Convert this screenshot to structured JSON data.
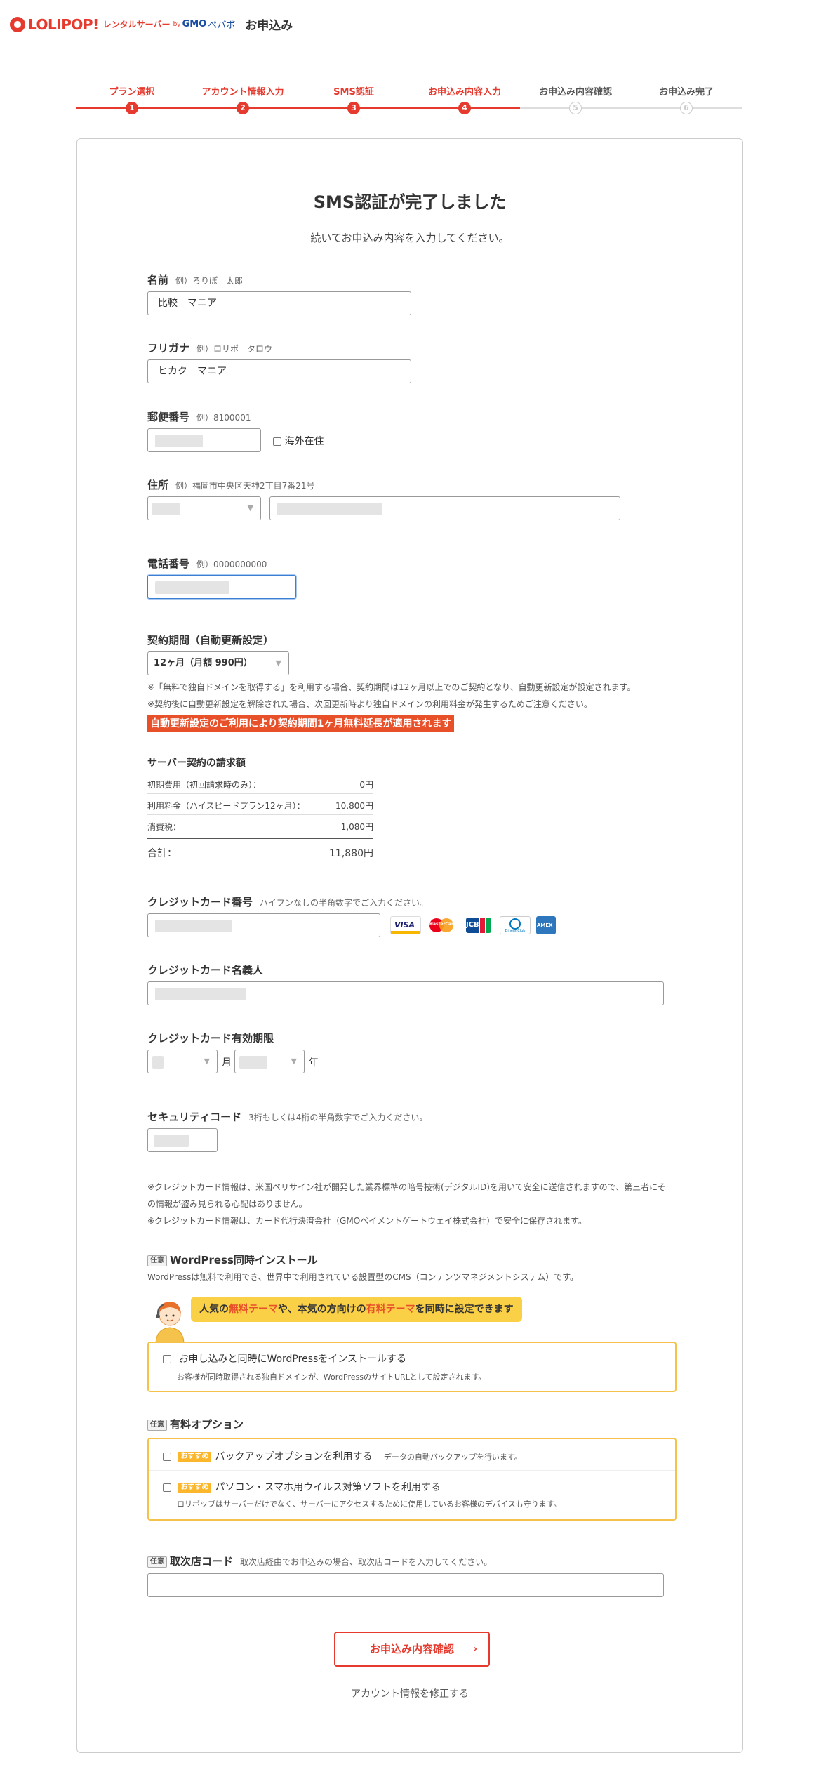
{
  "header": {
    "logo_text": "LOLIPOP!",
    "logo_sub": "レンタルサーバー",
    "logo_by": "by",
    "logo_gmo": "GMO",
    "logo_pepabo": "ペパボ",
    "page_title": "お申込み"
  },
  "steps": [
    {
      "label": "プラン選択",
      "num": "1",
      "state": "done"
    },
    {
      "label": "アカウント情報入力",
      "num": "2",
      "state": "done"
    },
    {
      "label": "SMS認証",
      "num": "3",
      "state": "done"
    },
    {
      "label": "お申込み内容入力",
      "num": "4",
      "state": "done"
    },
    {
      "label": "お申込み内容確認",
      "num": "5",
      "state": "todo"
    },
    {
      "label": "お申込み完了",
      "num": "6",
      "state": "todo"
    }
  ],
  "main": {
    "title": "SMS認証が完了しました",
    "subtitle": "続いてお申込み内容を入力してください。"
  },
  "form": {
    "name": {
      "label": "名前",
      "example": "例）ろりぽ　太郎",
      "value": "比較　マニア"
    },
    "kana": {
      "label": "フリガナ",
      "example": "例）ロリポ　タロウ",
      "value": "ヒカク　マニア"
    },
    "zip": {
      "label": "郵便番号",
      "example": "例）8100001",
      "overseas_label": "海外在住"
    },
    "address": {
      "label": "住所",
      "example": "例）福岡市中央区天神2丁目7番21号"
    },
    "phone": {
      "label": "電話番号",
      "example": "例）0000000000"
    },
    "contract": {
      "label": "契約期間（自動更新設定）",
      "selected": "12ヶ月（月額 990円）",
      "note1": "※「無料で独自ドメインを取得する」を利用する場合、契約期間は12ヶ月以上でのご契約となり、自動更新設定が設定されます。",
      "note2": "※契約後に自動更新設定を解除された場合、次回更新時より独自ドメインの利用料金が発生するためご注意ください。",
      "promo": "自動更新設定のご利用により契約期間1ヶ月無料延長が適用されます"
    },
    "billing": {
      "title": "サーバー契約の請求額",
      "rows": [
        {
          "label": "初期費用（初回請求時のみ）：",
          "value": "0円"
        },
        {
          "label": "利用料金（ハイスピードプラン12ヶ月）：",
          "value": "10,800円"
        },
        {
          "label": "消費税：",
          "value": "1,080円"
        }
      ],
      "total_label": "合計：",
      "total_value": "11,880円"
    },
    "card_number": {
      "label": "クレジットカード番号",
      "example": "ハイフンなしの半角数字でご入力ください。"
    },
    "card_brands": [
      "VISA",
      "MasterCard",
      "JCB",
      "Diners Club",
      "AMEX"
    ],
    "card_holder": {
      "label": "クレジットカード名義人"
    },
    "card_expiry": {
      "label": "クレジットカード有効期限",
      "month_unit": "月",
      "year_unit": "年"
    },
    "security_code": {
      "label": "セキュリティコード",
      "example": "3桁もしくは4桁の半角数字でご入力ください。"
    },
    "card_notes": [
      "※クレジットカード情報は、米国ベリサイン社が開発した業界標準の暗号技術(デジタルID)を用いて安全に送信されますので、第三者にそ",
      "の情報が盗み見られる心配はありません。",
      "※クレジットカード情報は、カード代行決済会社（GMOペイメントゲートウェイ株式会社）で安全に保存されます。"
    ],
    "wordpress": {
      "badge": "任意",
      "title": "WordPress同時インストール",
      "desc": "WordPressは無料で利用でき、世界中で利用されている設置型のCMS（コンテンツマネジメントシステム）です。",
      "bubble_a": "人気の",
      "bubble_b": "無料テーマ",
      "bubble_c": "や、本気の方向けの",
      "bubble_d": "有料テーマ",
      "bubble_e": "を同時に設定できます",
      "check_label": "お申し込みと同時にWordPressをインストールする",
      "check_sub": "お客様が同時取得される独自ドメインが、WordPressのサイトURLとして設定されます。"
    },
    "options": {
      "badge": "任意",
      "title": "有料オプション",
      "recommend": "おすすめ",
      "items": [
        {
          "label": "バックアップオプションを利用する",
          "desc": "データの自動バックアップを行います。",
          "sub": ""
        },
        {
          "label": "パソコン・スマホ用ウイルス対策ソフトを利用する",
          "desc": "",
          "sub": "ロリポップはサーバーだけでなく、サーバーにアクセスするために使用しているお客様のデバイスも守ります。"
        }
      ]
    },
    "agency": {
      "badge": "任意",
      "label": "取次店コード",
      "example": "取次店経由でお申込みの場合、取次店コードを入力してください。"
    }
  },
  "actions": {
    "confirm": "お申込み内容確認",
    "chevron": "›",
    "edit_account": "アカウント情報を修正する"
  },
  "colors": {
    "accent": "#e63a2e",
    "promo": "#e8502a",
    "highlight": "#fad046",
    "box_border": "#f5c34b"
  }
}
